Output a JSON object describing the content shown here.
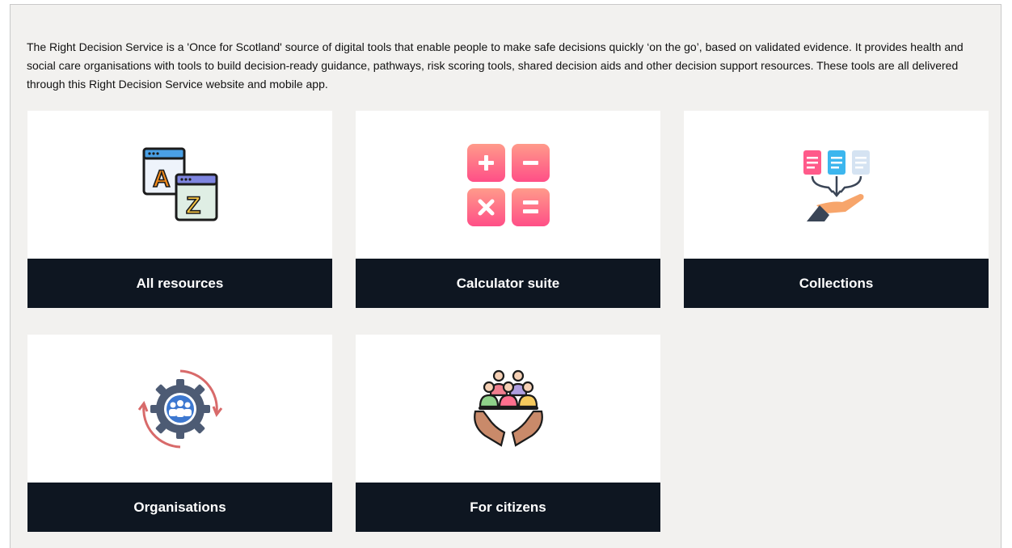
{
  "intro_text": "The Right Decision Service is a 'Once for Scotland' source of digital tools that enable people to make safe decisions quickly ‘on the go’, based on validated evidence. It provides health and social care organisations with tools to build decision-ready guidance, pathways, risk scoring tools, shared decision aids and other decision support resources. These tools are all delivered through this Right Decision Service website and mobile app.",
  "cards": [
    {
      "label": "All resources",
      "icon": "a-to-z-icon"
    },
    {
      "label": "Calculator suite",
      "icon": "calculator-icon"
    },
    {
      "label": "Collections",
      "icon": "collections-icon"
    },
    {
      "label": "Organisations",
      "icon": "organisations-icon"
    },
    {
      "label": "For citizens",
      "icon": "citizens-icon"
    }
  ],
  "colors": {
    "panel_background": "#f2f1ef",
    "label_bar": "#0e1621",
    "label_text": "#ffffff"
  }
}
